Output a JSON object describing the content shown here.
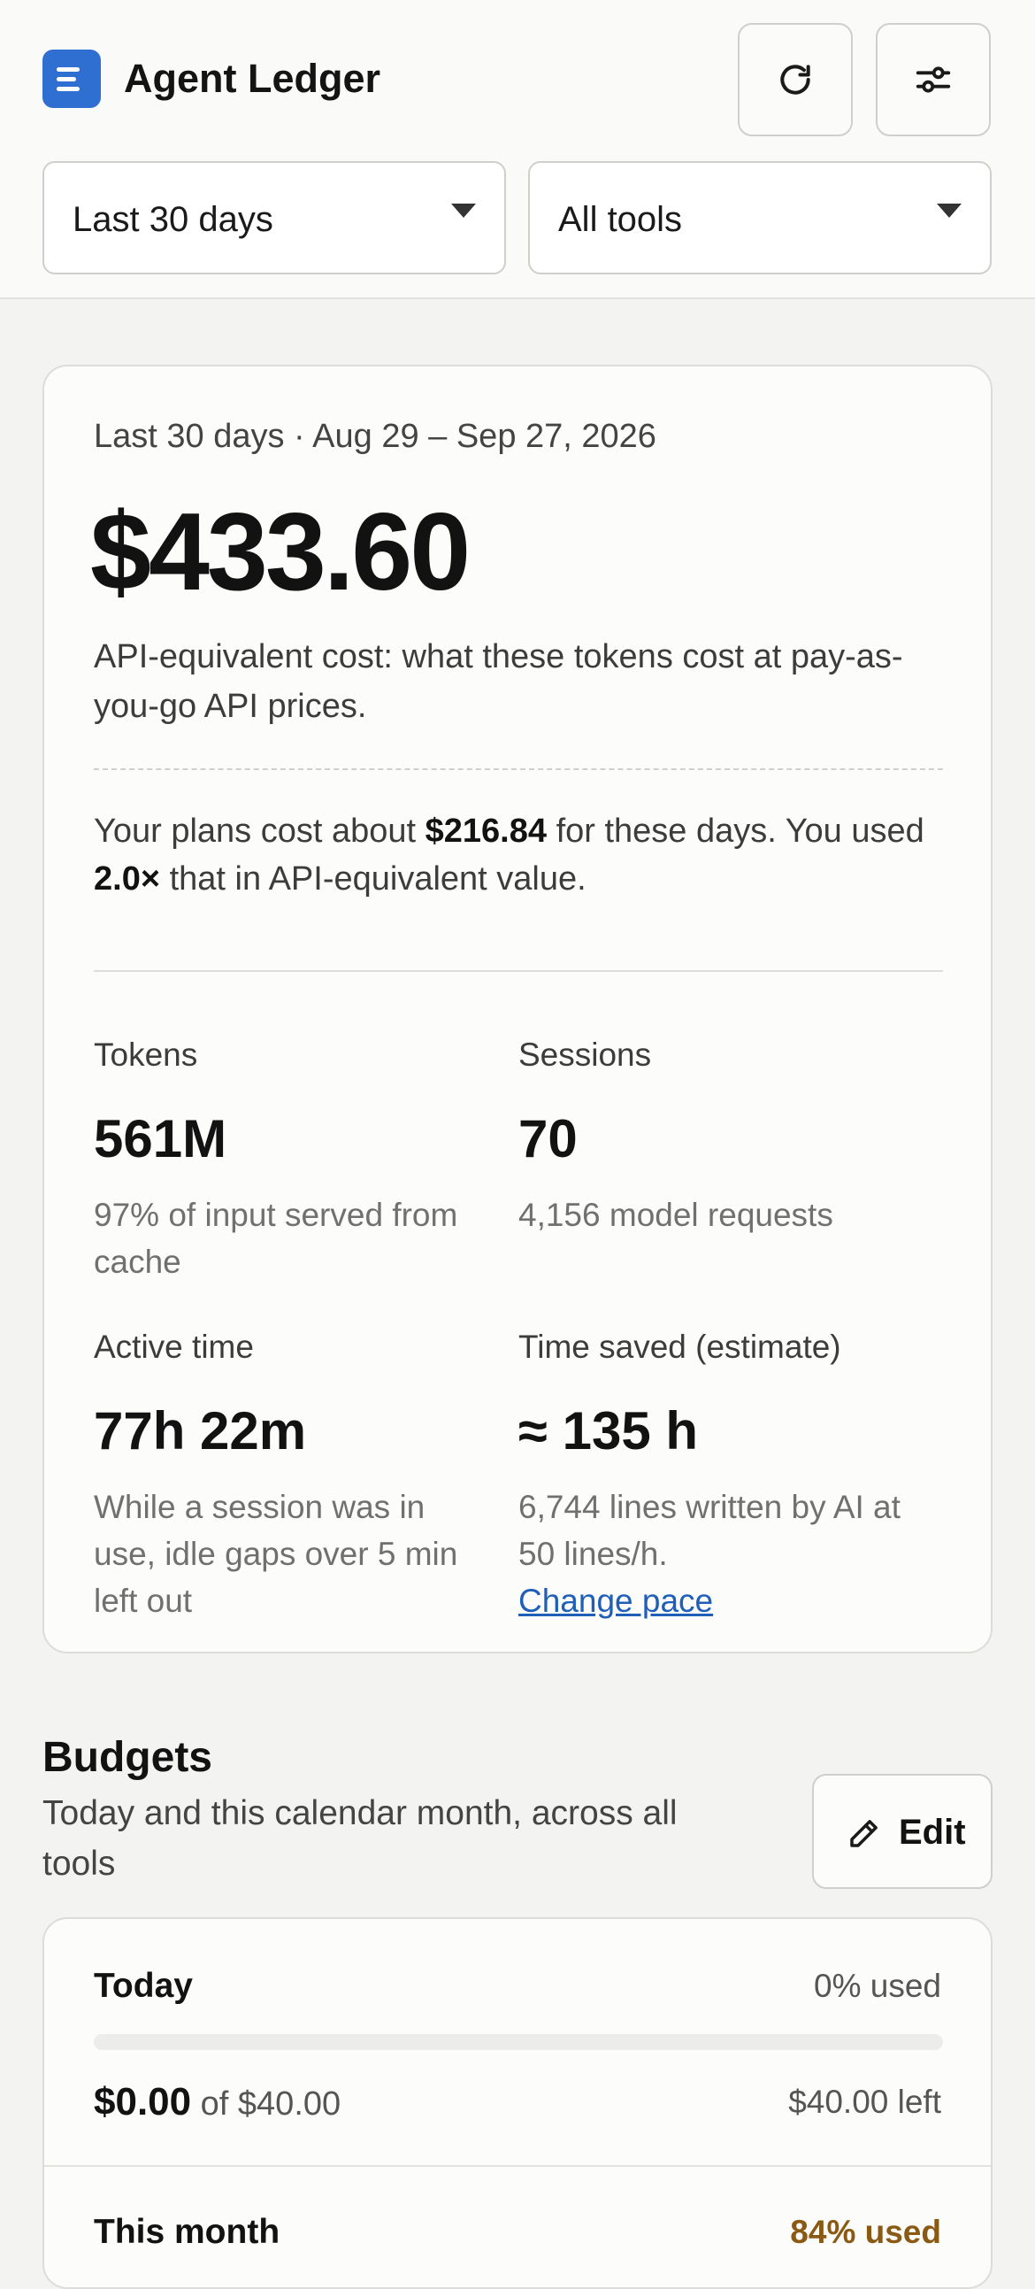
{
  "app": {
    "title": "Agent Ledger",
    "accent_color": "#2f6fd1",
    "logo_icon": "ledger-icon"
  },
  "header": {
    "refresh_icon": "refresh-icon",
    "settings_icon": "sliders-icon",
    "range_select": {
      "value": "Last 30 days"
    },
    "tools_select": {
      "value": "All tools"
    }
  },
  "summary": {
    "period": "Last 30 days · Aug 29 – Sep 27, 2026",
    "total_cost": "$433.60",
    "total_note": "API-equivalent cost: what these tokens cost at pay-as-you-go API prices.",
    "plans": {
      "prefix": "Your plans cost about ",
      "amount": "$216.84",
      "middle": " for these days. You used ",
      "multiplier": "2.0×",
      "suffix": " that in API-equivalent value."
    },
    "stats": {
      "tokens": {
        "label": "Tokens",
        "value": "561M",
        "desc": "97% of input served from cache"
      },
      "sessions": {
        "label": "Sessions",
        "value": "70",
        "desc": "4,156 model requests"
      },
      "active_time": {
        "label": "Active time",
        "value": "77h 22m",
        "desc": "While a session was in use, idle gaps over 5 min left out"
      },
      "time_saved": {
        "label": "Time saved (estimate)",
        "value": "≈ 135 h",
        "desc": "6,744 lines written by AI at 50 lines/h.",
        "link": "Change pace"
      }
    }
  },
  "budgets": {
    "title": "Budgets",
    "subtitle": "Today and this calendar month, across all tools",
    "edit_label": "Edit",
    "edit_icon": "pencil-icon",
    "today": {
      "label": "Today",
      "used": "0% used",
      "used_fraction": 0,
      "spent": "$0.00",
      "of_limit": " of $40.00",
      "left": "$40.00 left"
    },
    "month": {
      "label": "This month",
      "used": "84% used",
      "used_fraction": 0.84,
      "warn_color": "#8a5a14"
    }
  }
}
